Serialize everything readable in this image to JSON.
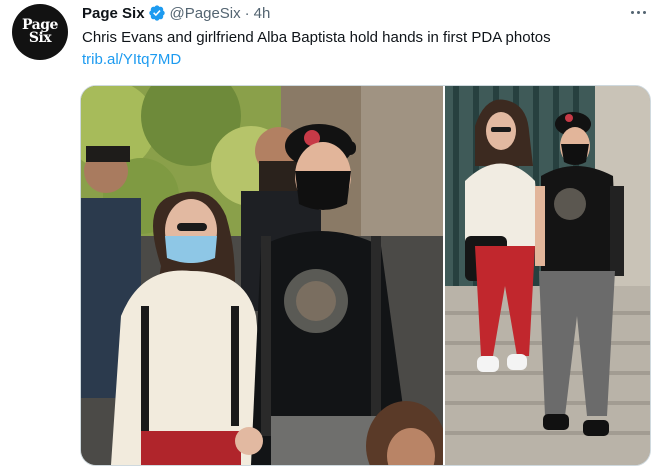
{
  "account": {
    "avatar_text_line1": "Page",
    "avatar_text_line2": "Six",
    "display_name": "Page Six",
    "handle": "@PageSix",
    "separator": "·",
    "timestamp": "4h",
    "verified_color": "#1d9bf0"
  },
  "tweet": {
    "text": "Chris Evans and girlfriend Alba Baptista hold hands in first PDA photos",
    "link": "trib.al/YItq7MD"
  },
  "media": {
    "photo_count": 2,
    "photo_1_subject": "couple walking holding hands, wearing face masks",
    "photo_2_subject": "couple walking down stone steps, wearing face masks"
  },
  "icons": {
    "verified": "verified-badge-icon",
    "more": "more-options-icon"
  },
  "colors": {
    "text_primary": "#0f1419",
    "text_secondary": "#536471",
    "link": "#1d9bf0",
    "border": "#cfd9de"
  }
}
